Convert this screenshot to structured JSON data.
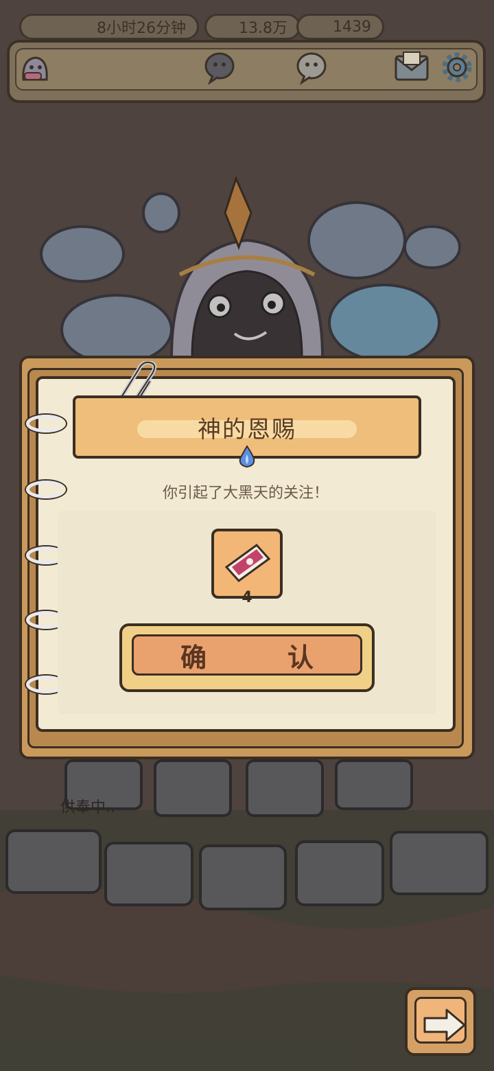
{
  "status_bar": {
    "timer": "8小时26分钟",
    "currency_1": "13.8万",
    "currency_2": "1439"
  },
  "dialog": {
    "title": "神的恩赐",
    "message": "你引起了大黑天的关注！",
    "reward": {
      "icon": "ticket-icon",
      "count": "4"
    },
    "confirm_label": "确　认"
  },
  "scene": {
    "offering_status": "供奉中.."
  },
  "colors": {
    "panel_wood": "#c99a5c",
    "paper": "#f3ead4",
    "title_plate": "#efbe7b",
    "confirm": "#e9a26e",
    "outline": "#3b2e22"
  }
}
